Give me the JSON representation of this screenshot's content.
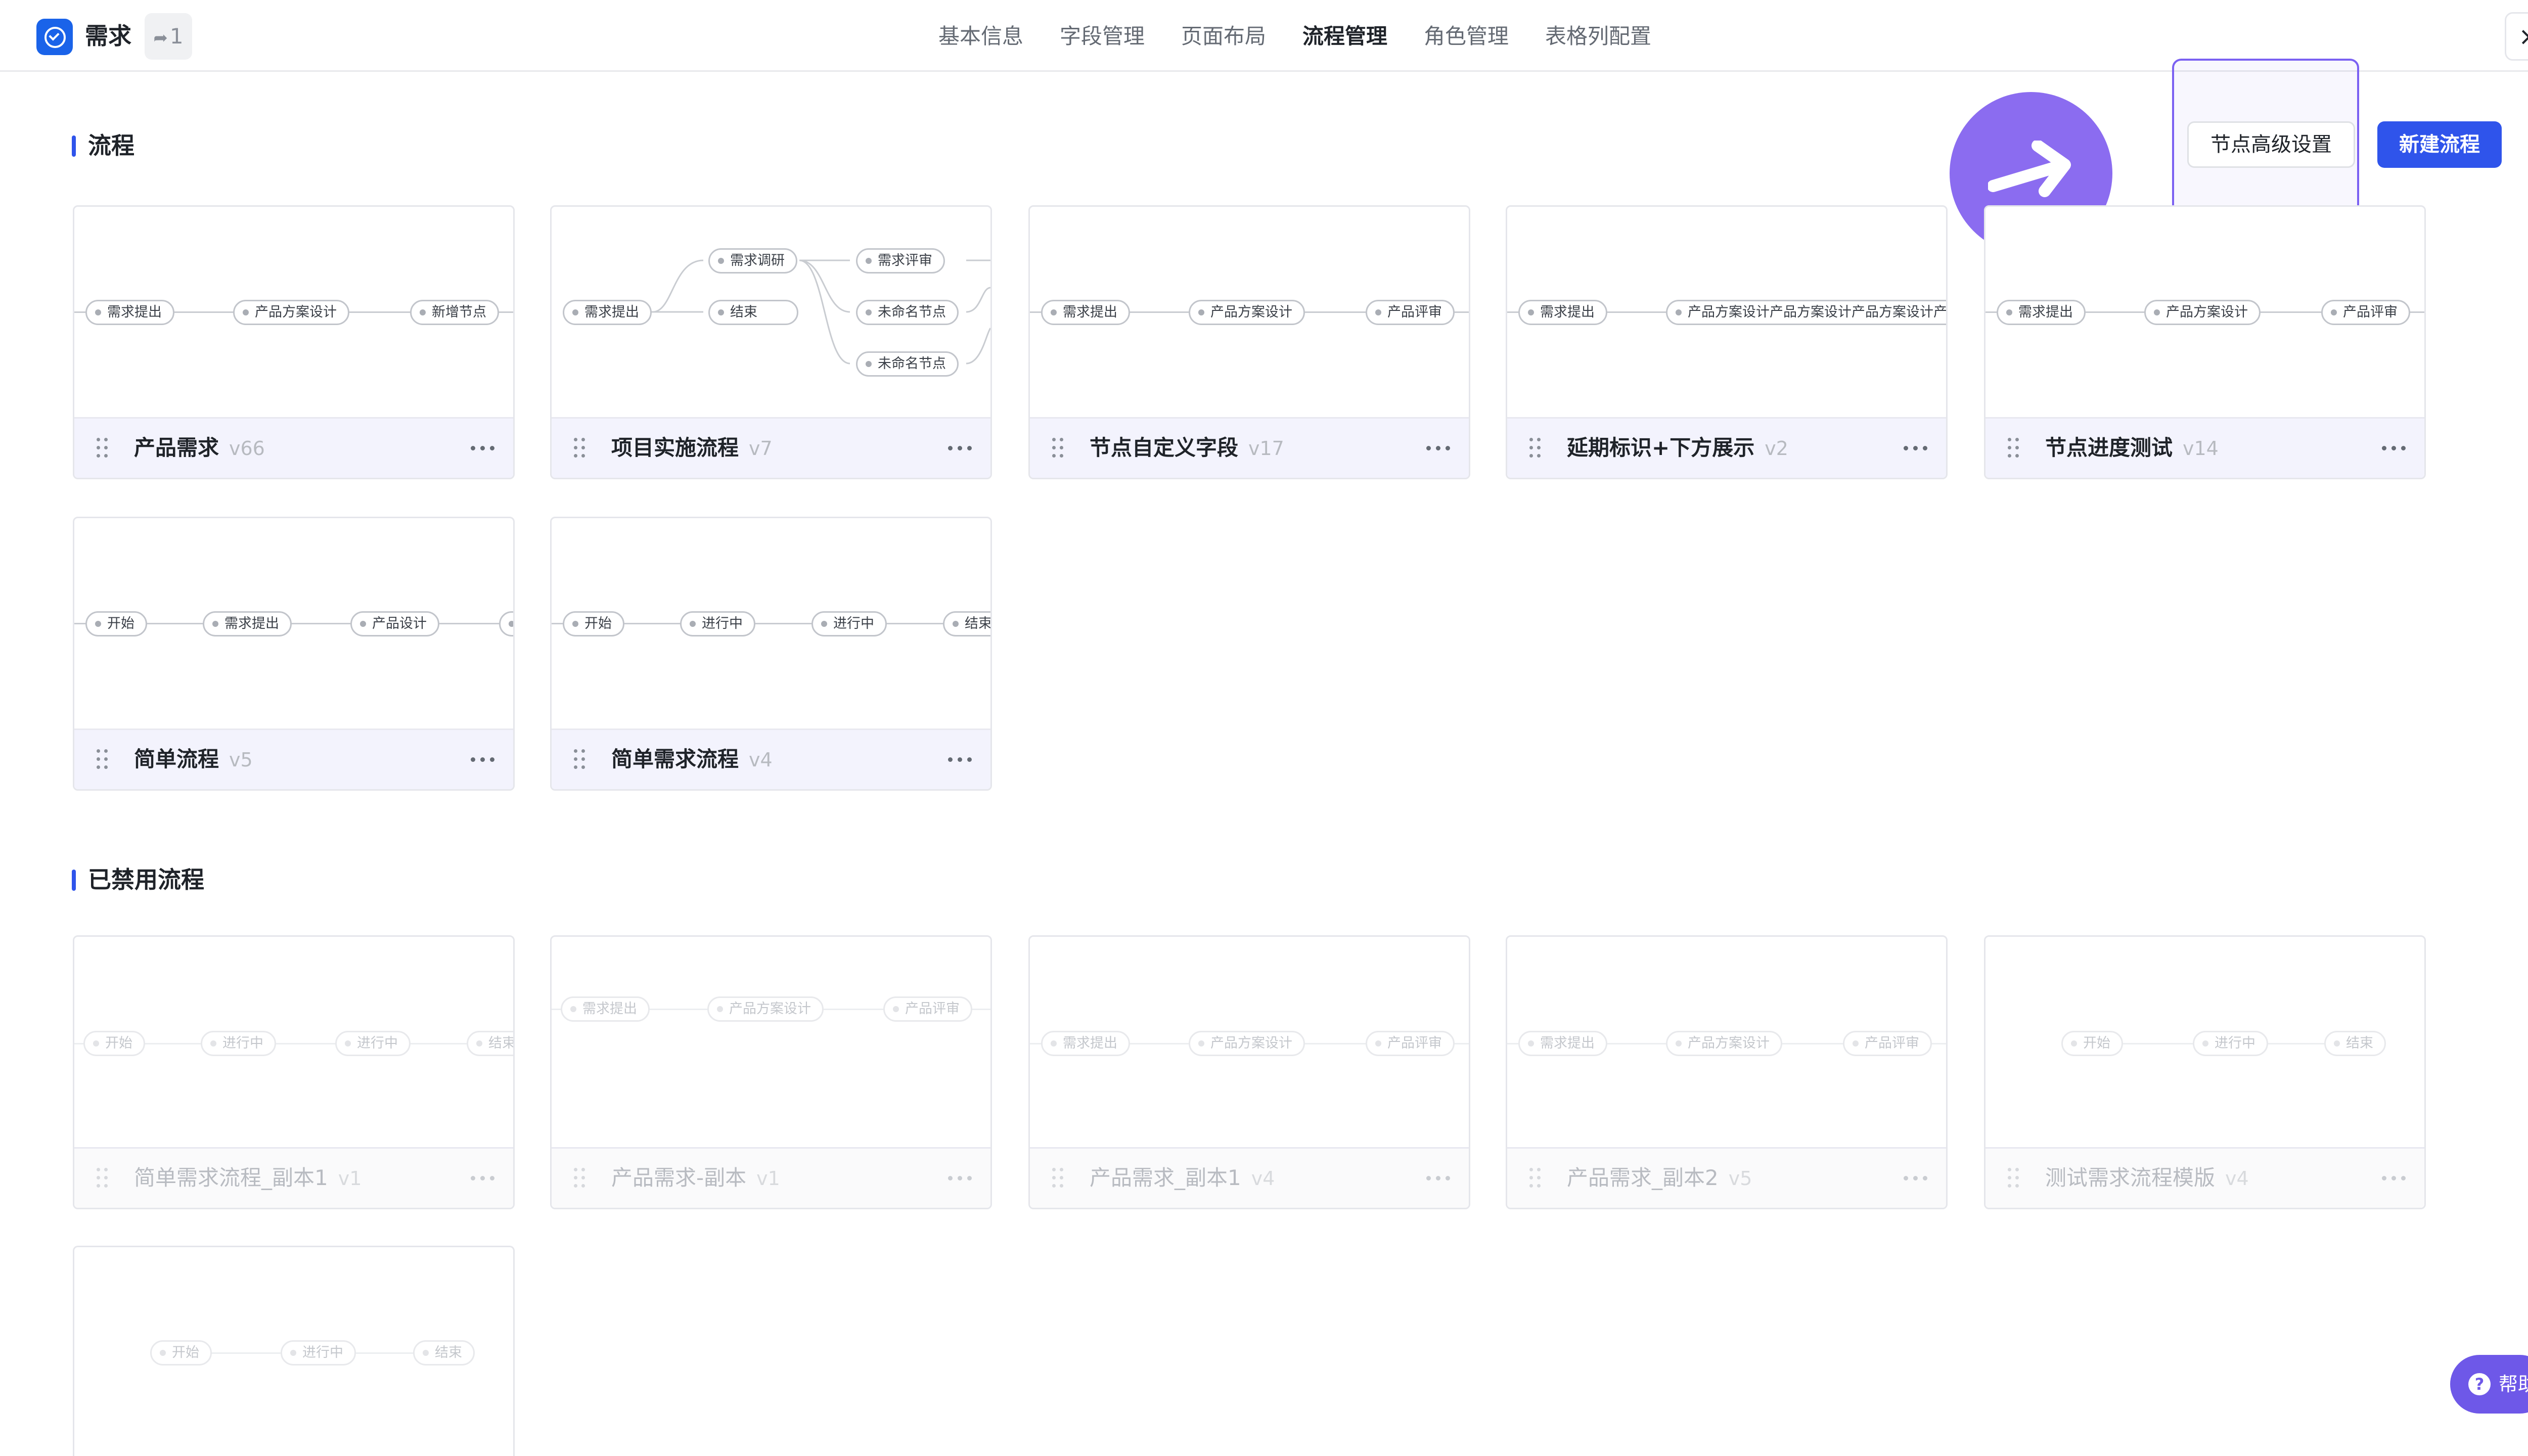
{
  "header": {
    "app_title": "需求",
    "share_count": "1",
    "tabs": [
      {
        "label": "基本信息",
        "active": false
      },
      {
        "label": "字段管理",
        "active": false
      },
      {
        "label": "页面布局",
        "active": false
      },
      {
        "label": "流程管理",
        "active": true
      },
      {
        "label": "角色管理",
        "active": false
      },
      {
        "label": "表格列配置",
        "active": false
      }
    ],
    "close_icon": "×"
  },
  "sections": {
    "enabled_title": "流程",
    "disabled_title": "已禁用流程"
  },
  "actions": {
    "advanced_label": "节点高级设置",
    "new_label": "新建流程"
  },
  "flows": [
    {
      "name": "产品需求",
      "version": "v66",
      "disabled": false,
      "nodes": [
        "需求提出",
        "产品方案设计",
        "新增节点"
      ]
    },
    {
      "name": "项目实施流程",
      "version": "v7",
      "disabled": false,
      "nodes": [
        "需求提出",
        "需求调研",
        "结束",
        "需求评审",
        "未命名节点",
        "未命名节点"
      ]
    },
    {
      "name": "节点自定义字段",
      "version": "v17",
      "disabled": false,
      "nodes": [
        "需求提出",
        "产品方案设计",
        "产品评审"
      ]
    },
    {
      "name": "延期标识+下方展示",
      "version": "v2",
      "disabled": false,
      "nodes": [
        "需求提出",
        "产品方案设计产品方案设计产品方案设计产品方案设计"
      ]
    },
    {
      "name": "节点进度测试",
      "version": "v14",
      "disabled": false,
      "nodes": [
        "需求提出",
        "产品方案设计",
        "产品评审"
      ]
    },
    {
      "name": "简单流程",
      "version": "v5",
      "disabled": false,
      "nodes": [
        "开始",
        "需求提出",
        "产品设计",
        ""
      ]
    },
    {
      "name": "简单需求流程",
      "version": "v4",
      "disabled": false,
      "nodes": [
        "开始",
        "进行中",
        "进行中",
        "结束"
      ]
    },
    {
      "name": "简单需求流程_副本1",
      "version": "v1",
      "disabled": true,
      "nodes": [
        "开始",
        "进行中",
        "进行中",
        "结束"
      ]
    },
    {
      "name": "产品需求-副本",
      "version": "v1",
      "disabled": true,
      "nodes": [
        "需求提出",
        "产品方案设计",
        "产品评审"
      ]
    },
    {
      "name": "产品需求_副本1",
      "version": "v4",
      "disabled": true,
      "nodes": [
        "需求提出",
        "产品方案设计",
        "产品评审"
      ]
    },
    {
      "name": "产品需求_副本2",
      "version": "v5",
      "disabled": true,
      "nodes": [
        "需求提出",
        "产品方案设计",
        "产品评审"
      ]
    },
    {
      "name": "测试需求流程模版",
      "version": "v4",
      "disabled": true,
      "nodes": [
        "开始",
        "进行中",
        "结束"
      ]
    },
    {
      "name": "",
      "version": "",
      "disabled": true,
      "nodes": [
        "开始",
        "进行中",
        "结束"
      ]
    }
  ],
  "help": {
    "label": "帮助",
    "icon": "?"
  },
  "colors": {
    "primary": "#2f54eb",
    "tour": "#8b6cf0",
    "help": "#6e58e8",
    "logo": "#1a63e9"
  }
}
